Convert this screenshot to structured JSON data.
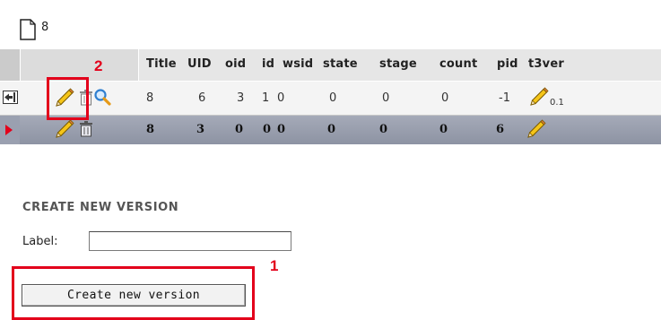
{
  "page": {
    "record_id": "8",
    "record_icon": "page-icon"
  },
  "table": {
    "headers": [
      "Title",
      "UID",
      "oid",
      "id",
      "wsid",
      "state",
      "stage",
      "count",
      "pid",
      "t3ver"
    ],
    "rows": [
      {
        "cells": [
          "8",
          "6",
          "3",
          "1",
          "0",
          "0",
          "0",
          "0",
          "-1"
        ],
        "t3ver": "0.1"
      },
      {
        "cells": [
          "8",
          "3",
          "0",
          "0",
          "0",
          "0",
          "0",
          "0",
          "6"
        ]
      }
    ]
  },
  "section": {
    "title": "CREATE NEW VERSION",
    "label_text": "Label:",
    "label_value": "",
    "button_label": "Create new version"
  },
  "annotations": {
    "marker_1": "1",
    "marker_2": "2"
  },
  "colors": {
    "annotation": "#e3001b",
    "header_bg": "#e6e6e6",
    "selected_row": "#9aa0b0"
  },
  "icons": [
    "page-icon",
    "swap-version-icon",
    "pencil-edit-icon",
    "trash-icon",
    "magnifier-icon",
    "red-arrow-icon"
  ]
}
